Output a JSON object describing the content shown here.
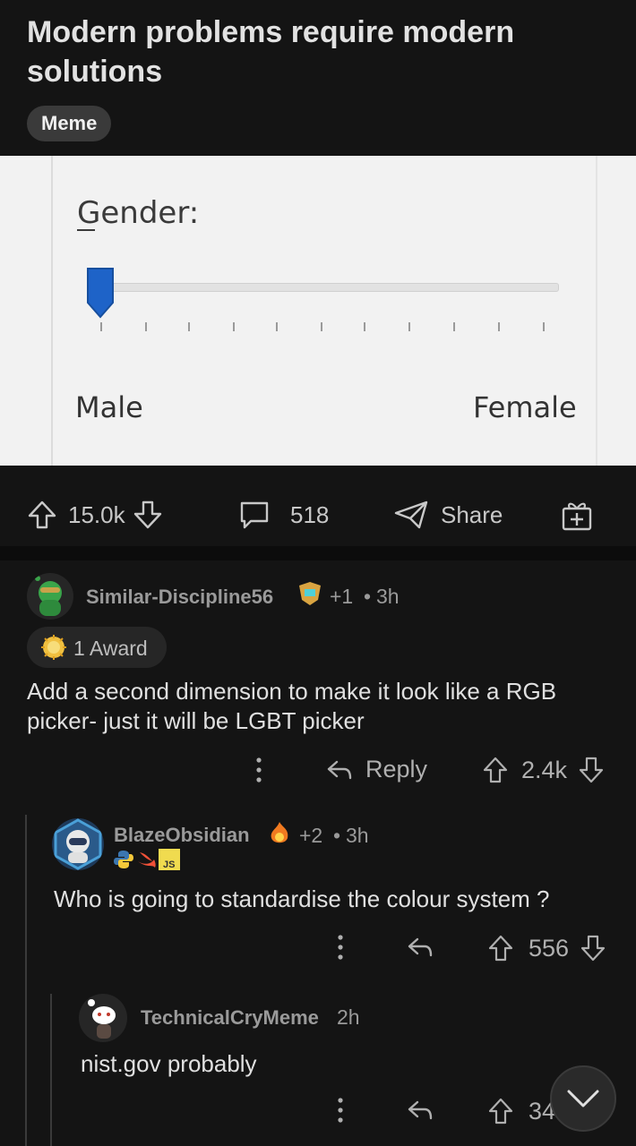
{
  "post": {
    "title": "Modern problems require modern solutions",
    "flair": "Meme"
  },
  "image": {
    "label": "Gender:",
    "left_label": "Male",
    "right_label": "Female",
    "slider_fraction": 0.0,
    "accent": "#1e63c8"
  },
  "actions": {
    "upvotes": "15.0k",
    "comments": "518",
    "share_label": "Share"
  },
  "comments": [
    {
      "username": "Similar-Discipline56",
      "karma": "+1",
      "time": "3h",
      "award": "1 Award",
      "body": "Add a second dimension to make it look like a RGB picker- just it will be LGBT picker",
      "reply_label": "Reply",
      "score": "2.4k"
    },
    {
      "username": "BlazeObsidian",
      "karma": "+2",
      "time": "3h",
      "body": "Who is going to standardise the colour system ?",
      "score": "556"
    },
    {
      "username": "TechnicalCryMeme",
      "time": "2h",
      "body": "nist.gov probably",
      "score": "34"
    }
  ],
  "icons": [
    "upvote-icon",
    "downvote-icon",
    "comment-icon",
    "share-icon",
    "gift-icon",
    "more-icon",
    "reply-icon",
    "chevron-down-icon"
  ]
}
